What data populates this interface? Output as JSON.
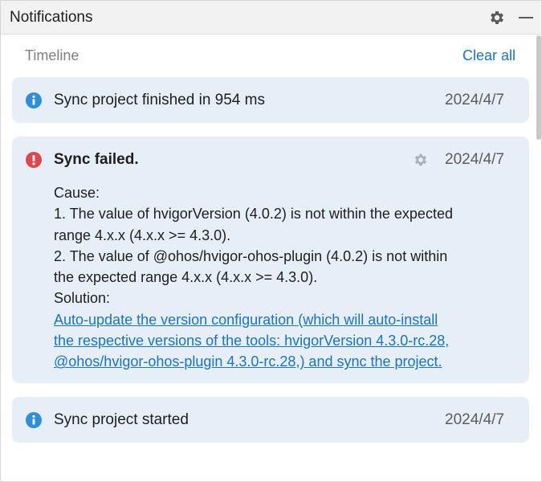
{
  "header": {
    "title": "Notifications",
    "settings_icon": "gear-icon",
    "minimize_icon": "minimize-icon"
  },
  "toolbar": {
    "timeline_label": "Timeline",
    "clear_all_label": "Clear all"
  },
  "notifications": [
    {
      "type": "info",
      "icon": "info-icon",
      "title": "Sync project finished in 954 ms",
      "date": "2024/4/7"
    },
    {
      "type": "error",
      "icon": "error-icon",
      "title": "Sync failed.",
      "date": "2024/4/7",
      "body": {
        "cause_label": "Cause:",
        "line1a": "1. The value of hvigorVersion (4.0.2) is not within the expected",
        "line1b": "range 4.x.x (4.x.x >= 4.3.0).",
        "line2a": "2. The value of @ohos/hvigor-ohos-plugin (4.0.2) is not within",
        "line2b": "the expected range 4.x.x (4.x.x >= 4.3.0).",
        "solution_label": "Solution:",
        "link_line1": "Auto-update the version configuration (which will auto-install",
        "link_line2": "the respective versions of the tools: hvigorVersion 4.3.0-rc.28,",
        "link_line3": "@ohos/hvigor-ohos-plugin 4.3.0-rc.28,) and sync the project."
      }
    },
    {
      "type": "info",
      "icon": "info-icon",
      "title": "Sync project started",
      "date": "2024/4/7"
    }
  ],
  "colors": {
    "accent": "#1a73c4",
    "info": "#2d8ed9",
    "error": "#e0464c",
    "card_bg": "#e6eef8"
  }
}
